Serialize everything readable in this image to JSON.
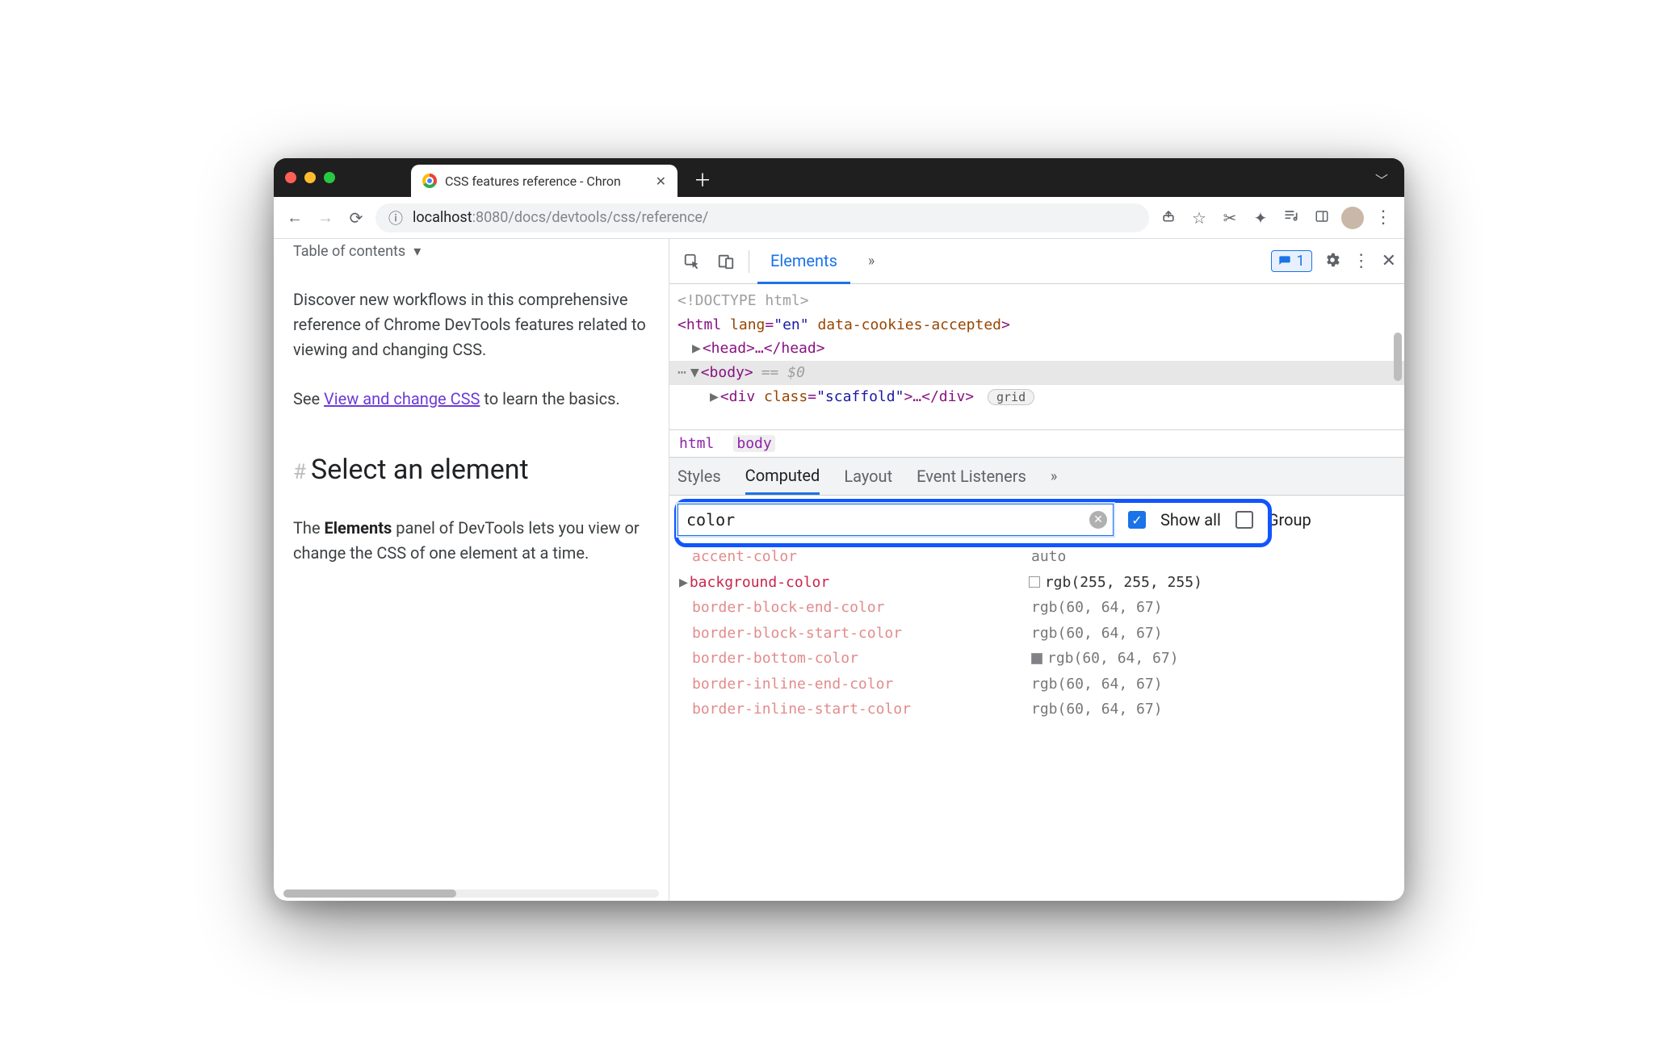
{
  "browser": {
    "tab_title": "CSS features reference - Chron",
    "url_host": "localhost",
    "url_port": ":8080",
    "url_path": "/docs/devtools/css/reference/"
  },
  "page": {
    "toc_label": "Table of contents",
    "para1a": "Discover new workflows in this comprehensive reference of Chrome DevTools features related to viewing and changing CSS.",
    "see": "See ",
    "link": "View and change CSS",
    "see_tail": " to learn the basics.",
    "hash": "#",
    "h2": "Select an element",
    "para2_pre": "The ",
    "para2_bold": "Elements",
    "para2_post": " panel of DevTools lets you view or change the CSS of one element at a time."
  },
  "devtools": {
    "tabs": {
      "elements": "Elements"
    },
    "issues_count": "1",
    "dom": {
      "doctype": "<!DOCTYPE html>",
      "html_open": "<html ",
      "html_lang_attr": "lang",
      "html_lang_val": "\"en\"",
      "html_cookies_attr": "data-cookies-accepted",
      "html_close": ">",
      "head": "<head>…</head>",
      "body_open": "<body>",
      "eq0": "== $0",
      "div_open": "<div ",
      "div_class_attr": "class",
      "div_class_val": "\"scaffold\"",
      "div_tail": ">…</div>",
      "grid_pill": "grid"
    },
    "crumbs": {
      "html": "html",
      "body": "body"
    },
    "subtabs": {
      "styles": "Styles",
      "computed": "Computed",
      "layout": "Layout",
      "events": "Event Listeners"
    },
    "filter": {
      "value": "color",
      "showall": "Show all",
      "group": "Group"
    },
    "computed": [
      {
        "prop": "accent-color",
        "val": "auto",
        "inh": true
      },
      {
        "prop": "background-color",
        "val": "rgb(255, 255, 255)",
        "sw": "white",
        "caret": true
      },
      {
        "prop": "border-block-end-color",
        "val": "rgb(60, 64, 67)",
        "inh": true
      },
      {
        "prop": "border-block-start-color",
        "val": "rgb(60, 64, 67)",
        "inh": true
      },
      {
        "prop": "border-bottom-color",
        "val": "rgb(60, 64, 67)",
        "inh": true,
        "sw": "grey"
      },
      {
        "prop": "border-inline-end-color",
        "val": "rgb(60, 64, 67)",
        "inh": true
      },
      {
        "prop": "border-inline-start-color",
        "val": "rgb(60, 64, 67)",
        "inh": true
      }
    ]
  }
}
